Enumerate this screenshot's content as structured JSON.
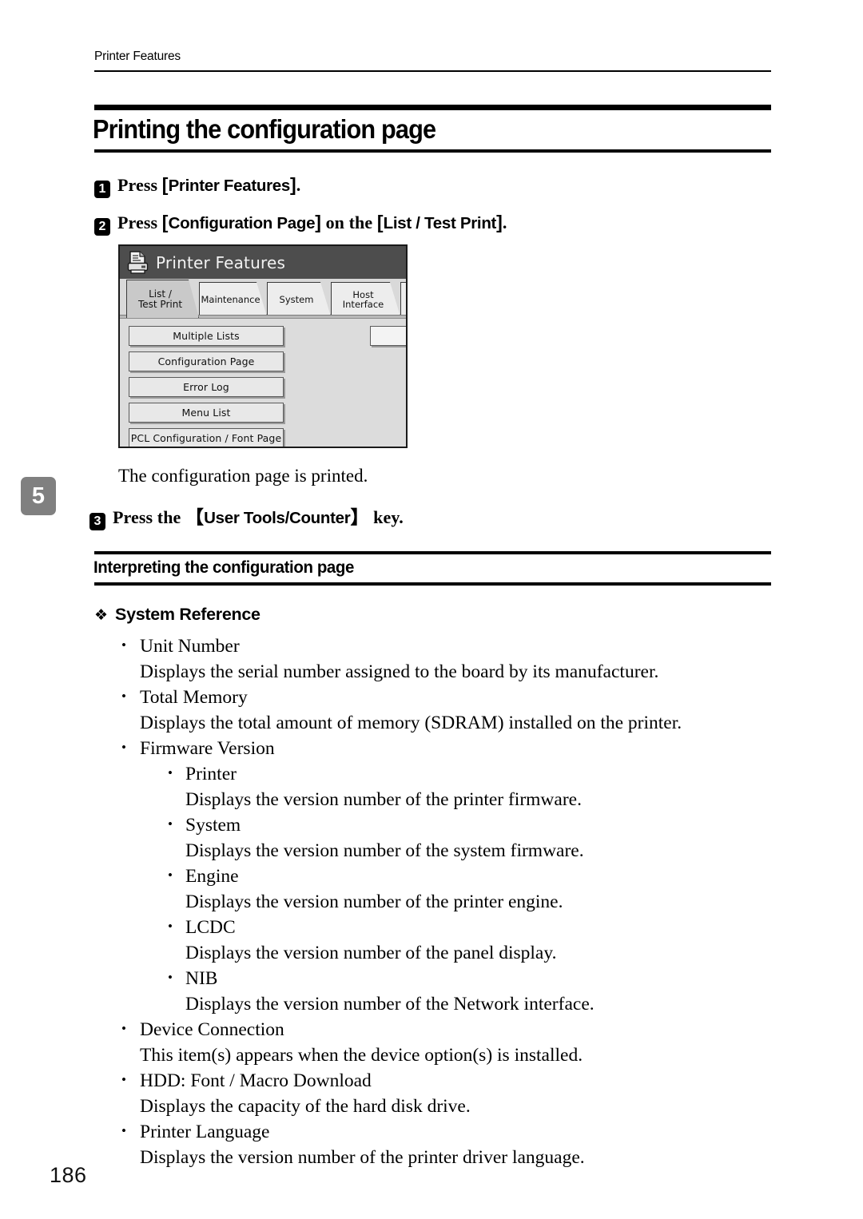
{
  "header": {
    "running_title": "Printer Features"
  },
  "chapter_tab": {
    "number": "5"
  },
  "page_number": "186",
  "section": {
    "h1_title": "Printing the configuration page",
    "h2_title": "Interpreting the configuration page"
  },
  "steps": [
    {
      "num": "1",
      "pre": "Press ",
      "bracket_open": "[",
      "label": "Printer Features",
      "bracket_close": "]",
      "post": "."
    },
    {
      "num": "2",
      "pre": "Press ",
      "bracket_open": "[",
      "label": "Configuration Page",
      "bracket_close": "]",
      "mid": " on the ",
      "bracket_open2": "[",
      "label2": "List / Test Print",
      "bracket_close2": "]",
      "post": "."
    },
    {
      "num": "3",
      "pre": "Press the ",
      "bracket_open": "【",
      "label": "User Tools/Counter",
      "bracket_close": "】",
      "post": " key."
    }
  ],
  "result_line": "The configuration page is printed.",
  "diamond_heading": {
    "glyph": "❖",
    "label": "System Reference"
  },
  "bullets": [
    {
      "term": "Unit Number",
      "desc": "Displays the serial number assigned to the board by its manufacturer."
    },
    {
      "term": "Total Memory",
      "desc": "Displays the total amount of memory (SDRAM) installed on the printer."
    },
    {
      "term": "Firmware Version",
      "desc": "",
      "children": [
        {
          "term": "Printer",
          "desc": "Displays the version number of the printer firmware."
        },
        {
          "term": "System",
          "desc": "Displays the version number of the system firmware."
        },
        {
          "term": "Engine",
          "desc": "Displays the version number of the printer engine."
        },
        {
          "term": "LCDC",
          "desc": "Displays the version number of the panel display."
        },
        {
          "term": "NIB",
          "desc": "Displays the version number of the Network interface."
        }
      ]
    },
    {
      "term": "Device Connection",
      "desc": "This item(s) appears when the device option(s) is installed."
    },
    {
      "term": "HDD: Font / Macro Download",
      "desc": "Displays the capacity of the hard disk drive."
    },
    {
      "term": "Printer Language",
      "desc": "Displays the version number of the printer driver language."
    }
  ],
  "lcd": {
    "title": "Printer Features",
    "icon": "printer-icon",
    "tabs": [
      {
        "label_line1": "List /",
        "label_line2": "Test Print",
        "active": true
      },
      {
        "label_line1": "Maintenance",
        "label_line2": "",
        "active": false
      },
      {
        "label_line1": "System",
        "label_line2": "",
        "active": false
      },
      {
        "label_line1": "Host Interface",
        "label_line2": "",
        "active": false
      }
    ],
    "buttons": [
      "Multiple Lists",
      "Configuration Page",
      "Error Log",
      "Menu List",
      "PCL Configuration / Font Page"
    ]
  },
  "colors": {
    "titlebar": "#4d4d4d",
    "panel_bg": "#dcdcdc",
    "chapter_tab": "#808080",
    "rule": "#000000"
  }
}
